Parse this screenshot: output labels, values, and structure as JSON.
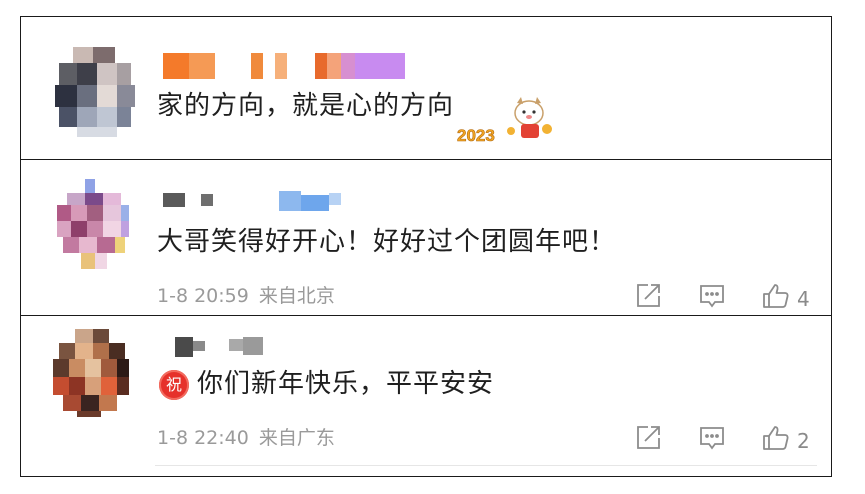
{
  "comments": [
    {
      "text": "家的方向，就是心的方向",
      "sticker": "2023"
    },
    {
      "text": "大哥笑得好开心！好好过个团圆年吧！",
      "date": "1-8 20:59",
      "location": "来自北京",
      "likes": "4"
    },
    {
      "badge": "祝",
      "text": "你们新年快乐，平平安安",
      "date": "1-8 22:40",
      "location": "来自广东",
      "likes": "2"
    }
  ],
  "icons": {
    "share": "share-icon",
    "comment": "comment-icon",
    "like": "thumbs-up-icon"
  },
  "colors": {
    "badge": "#e6312b",
    "meta_text": "#9a9a9a",
    "border": "#1a1a1a"
  }
}
